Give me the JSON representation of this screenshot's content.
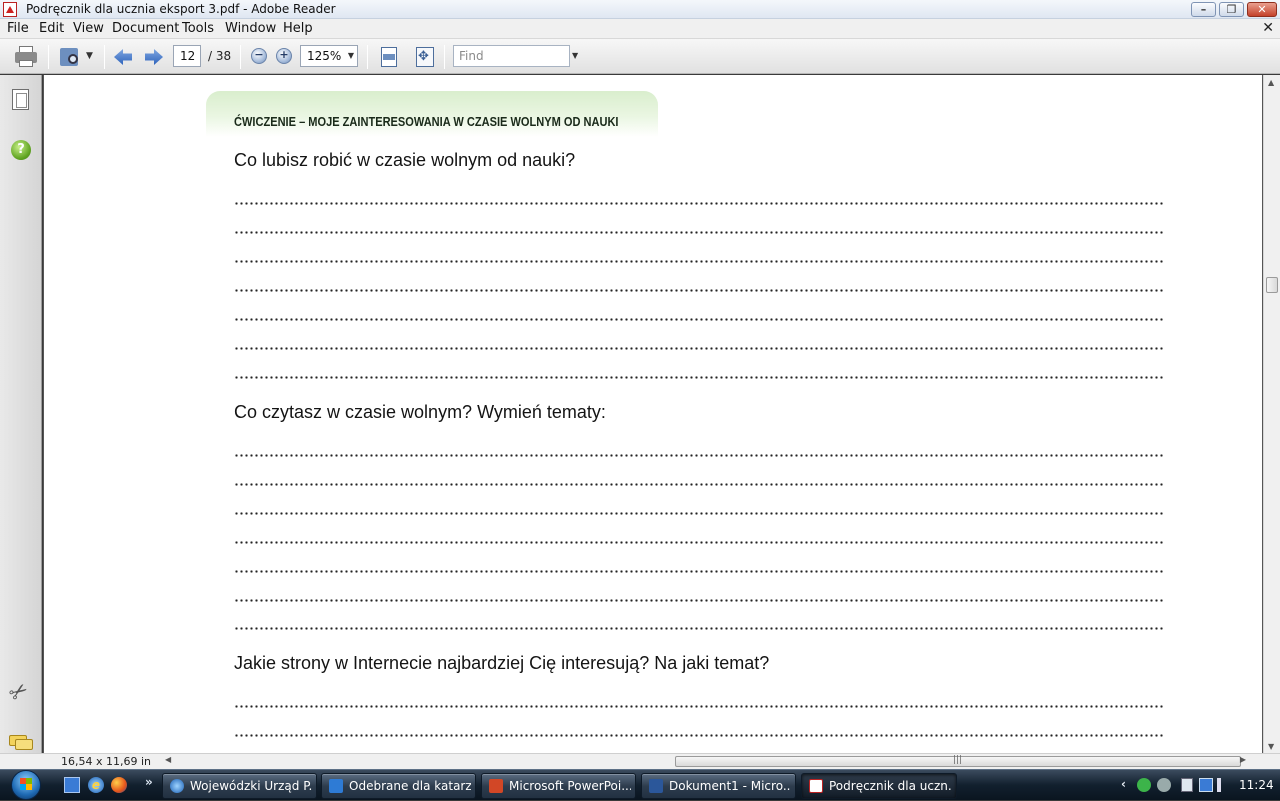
{
  "window": {
    "title": "Podręcznik dla ucznia eksport 3.pdf - Adobe Reader",
    "min_label": "–",
    "max_label": "❐",
    "close_label": "✕"
  },
  "menu": {
    "items": [
      "File",
      "Edit",
      "View",
      "Document",
      "Tools",
      "Window",
      "Help"
    ],
    "doc_close": "✕"
  },
  "toolbar": {
    "page_current": "12",
    "page_total": "/ 38",
    "zoom_value": "125%",
    "zoom_out_label": "−",
    "zoom_in_label": "+",
    "find_placeholder": "Find",
    "icons": [
      "printer-icon",
      "review-icon",
      "previous-page-icon",
      "next-page-icon",
      "zoom-out-icon",
      "zoom-in-icon",
      "fit-page-icon",
      "fit-window-icon"
    ]
  },
  "left_nav": {
    "icons": [
      "pages-icon",
      "help-icon",
      "attachment-icon",
      "comments-icon"
    ],
    "help_label": "?"
  },
  "document": {
    "section_title": "ĆWICZENIE – MOJE ZAINTERESOWANIA W CZASIE WOLNYM OD NAUKI",
    "questions": [
      "Co lubisz robić w czasie wolnym od nauki?",
      "Co czytasz w czasie wolnym? Wymień tematy:",
      "Jakie strony w Internecie najbardziej Cię interesują? Na jaki temat?"
    ],
    "answer_lines_per_question": [
      7,
      7,
      2
    ]
  },
  "status": {
    "page_size": "16,54 x 11,69 in"
  },
  "taskbar": {
    "tasks": [
      {
        "label": "Wojewódzki Urząd P...",
        "icon": "internet-explorer-icon",
        "active": false
      },
      {
        "label": "Odebrane dla katarz...",
        "icon": "outlook-icon",
        "active": false
      },
      {
        "label": "Microsoft PowerPoi...",
        "icon": "powerpoint-icon",
        "active": false
      },
      {
        "label": "Dokument1 - Micro...",
        "icon": "word-icon",
        "active": false
      },
      {
        "label": "Podręcznik dla uczn...",
        "icon": "adobe-reader-icon",
        "active": true
      }
    ],
    "quick_launch": [
      "show-desktop-icon",
      "internet-explorer-icon",
      "firefox-icon"
    ],
    "quick_more": "»",
    "clock": "11:24"
  }
}
